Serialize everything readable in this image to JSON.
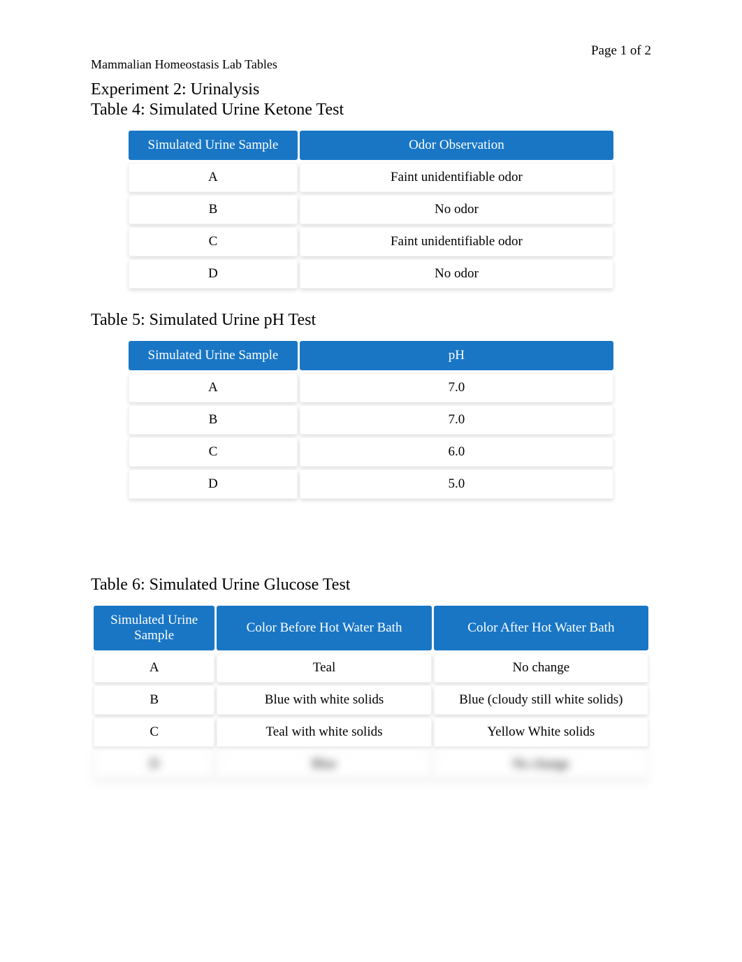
{
  "page_number": "Page 1 of 2",
  "doc_header": "Mammalian Homeostasis Lab Tables",
  "experiment_title": "Experiment 2: Urinalysis",
  "table4": {
    "title": "Table 4: Simulated Urine Ketone Test",
    "headers": [
      "Simulated Urine Sample",
      "Odor Observation"
    ],
    "rows": [
      {
        "sample": "A",
        "value": "Faint unidentifiable odor"
      },
      {
        "sample": "B",
        "value": "No odor"
      },
      {
        "sample": "C",
        "value": "Faint unidentifiable odor"
      },
      {
        "sample": "D",
        "value": "No odor"
      }
    ]
  },
  "table5": {
    "title": "Table 5: Simulated Urine pH Test",
    "headers": [
      "Simulated Urine Sample",
      "pH"
    ],
    "rows": [
      {
        "sample": "A",
        "value": "7.0"
      },
      {
        "sample": "B",
        "value": "7.0"
      },
      {
        "sample": "C",
        "value": "6.0"
      },
      {
        "sample": "D",
        "value": "5.0"
      }
    ]
  },
  "table6": {
    "title": "Table 6: Simulated Urine Glucose Test",
    "headers": [
      "Simulated Urine Sample",
      "Color Before Hot Water Bath",
      "Color After Hot Water Bath"
    ],
    "rows": [
      {
        "sample": "A",
        "before": "Teal",
        "after": "No change"
      },
      {
        "sample": "B",
        "before": "Blue with white solids",
        "after": "Blue (cloudy still white solids)"
      },
      {
        "sample": "C",
        "before": "Teal with white solids",
        "after": "Yellow White solids"
      },
      {
        "sample": "D",
        "before": "Blue",
        "after": "No change"
      }
    ]
  }
}
